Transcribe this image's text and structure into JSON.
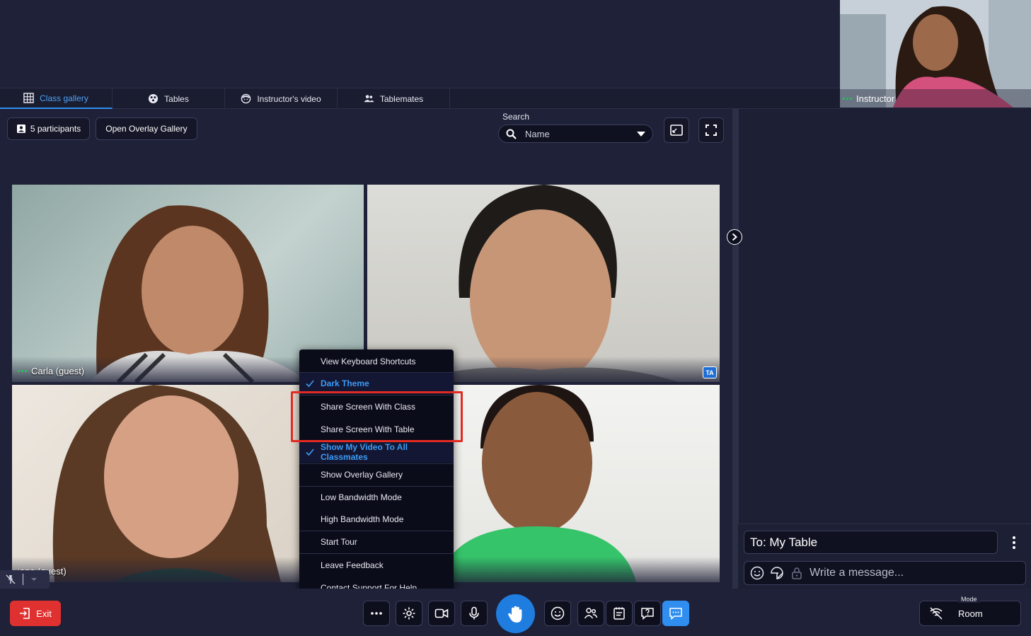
{
  "tabs": [
    {
      "label": "Class gallery",
      "icon": "grid-icon",
      "active": true
    },
    {
      "label": "Tables",
      "icon": "table-icon",
      "active": false
    },
    {
      "label": "Instructor's video",
      "icon": "instructor-icon",
      "active": false
    },
    {
      "label": "Tablemates",
      "icon": "people-icon",
      "active": false
    }
  ],
  "instructor": {
    "label": "Instructor"
  },
  "toolbar_top": {
    "participants_label": "5 participants",
    "overlay_label": "Open Overlay Gallery"
  },
  "search": {
    "label": "Search",
    "selected": "Name"
  },
  "tiles": [
    {
      "name": "Carla (guest)",
      "badge": ""
    },
    {
      "name": "",
      "badge": "TA"
    },
    {
      "name": "iana (guest)",
      "badge": ""
    },
    {
      "name": "",
      "badge": ""
    }
  ],
  "menu": {
    "items": [
      {
        "label": "View Keyboard Shortcuts",
        "checked": false
      },
      {
        "label": "Dark Theme",
        "checked": true
      },
      {
        "label": "Share Screen With Class",
        "checked": false
      },
      {
        "label": "Share Screen With Table",
        "checked": false
      },
      {
        "label": "Show My Video To All Classmates",
        "checked": true
      },
      {
        "label": "Show Overlay Gallery",
        "checked": false
      },
      {
        "label": "Low Bandwidth Mode",
        "checked": false
      },
      {
        "label": "High Bandwidth Mode",
        "checked": false
      },
      {
        "label": "Start Tour",
        "checked": false
      },
      {
        "label": "Leave Feedback",
        "checked": false
      },
      {
        "label": "Contact Support For Help",
        "checked": false
      }
    ]
  },
  "chat": {
    "to_label": "To: My Table",
    "message_placeholder": "Write a message..."
  },
  "bottom": {
    "exit_label": "Exit",
    "mode_title": "Mode",
    "mode_value": "Room"
  },
  "colors": {
    "accent": "#2f8ef0",
    "background": "#1f2138",
    "exit": "#e03131",
    "highlight": "#e32a22",
    "status_green": "#22c55e"
  }
}
